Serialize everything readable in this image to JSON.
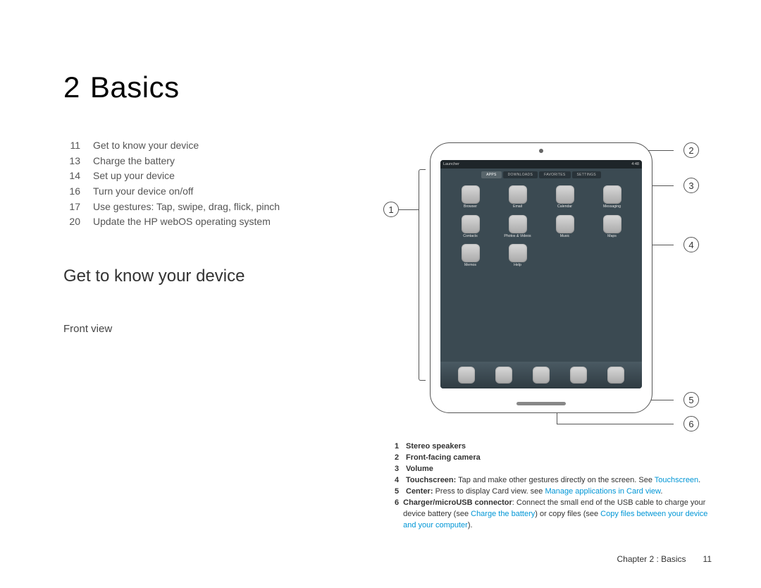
{
  "chapter": {
    "number": "2",
    "title": "Basics"
  },
  "toc": [
    {
      "page": "11",
      "label": "Get to know your device"
    },
    {
      "page": "13",
      "label": "Charge the battery"
    },
    {
      "page": "14",
      "label": "Set up your device"
    },
    {
      "page": "16",
      "label": "Turn your device on/off"
    },
    {
      "page": "17",
      "label": "Use gestures: Tap, swipe, drag, flick, pinch"
    },
    {
      "page": "20",
      "label": "Update the HP webOS operating system"
    }
  ],
  "section_heading": "Get to know your device",
  "subheading": "Front view",
  "device_ui": {
    "status_left": "Launcher",
    "status_right": "4:48",
    "tabs": [
      "APPS",
      "DOWNLOADS",
      "FAVORITES",
      "SETTINGS"
    ],
    "apps": [
      "Browser",
      "Email",
      "Calendar",
      "Messaging",
      "Contacts",
      "Photos & Videos",
      "Music",
      "Maps",
      "Memos",
      "Help"
    ]
  },
  "callouts": {
    "c1": "1",
    "c2": "2",
    "c3": "3",
    "c4": "4",
    "c5": "5",
    "c6": "6"
  },
  "legend": {
    "r1": {
      "n": "1",
      "bold": "Stereo speakers"
    },
    "r2": {
      "n": "2",
      "bold": "Front-facing camera"
    },
    "r3": {
      "n": "3",
      "bold": "Volume"
    },
    "r4": {
      "n": "4",
      "bold": "Touchscreen:",
      "text": " Tap and make other gestures directly on the screen. See ",
      "link": "Touchscreen",
      "after": "."
    },
    "r5": {
      "n": "5",
      "bold": "Center:",
      "text": " Press to display Card view. see ",
      "link": "Manage applications in Card view",
      "after": "."
    },
    "r6": {
      "n": "6",
      "bold": "Charger/microUSB connector",
      "text": ": Connect the small end of the USB cable to charge your device battery (see ",
      "link1": "Charge the battery",
      "mid": ") or copy files (see ",
      "link2": "Copy files between your device and your computer",
      "after": ")."
    }
  },
  "footer": {
    "chapter_label": "Chapter 2 : Basics",
    "page": "11"
  }
}
